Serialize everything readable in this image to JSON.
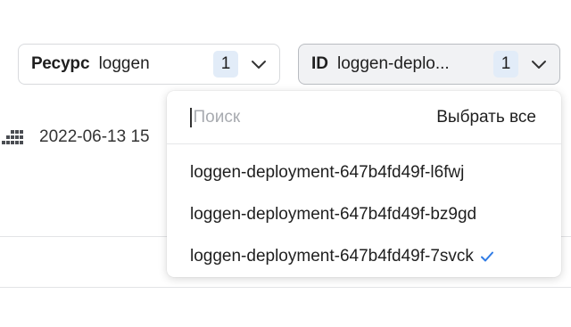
{
  "filters": {
    "resource": {
      "name": "Ресурс",
      "value": "loggen",
      "count": "1"
    },
    "id": {
      "name": "ID",
      "value": "loggen-deplo...",
      "count": "1"
    }
  },
  "row": {
    "date": "2022-06-13 15"
  },
  "dropdown": {
    "search_placeholder": "Поиск",
    "select_all": "Выбрать все",
    "items": [
      {
        "label": "loggen-deployment-647b4fd49f-l6fwj",
        "selected": false
      },
      {
        "label": "loggen-deployment-647b4fd49f-bz9gd",
        "selected": false
      },
      {
        "label": "loggen-deployment-647b4fd49f-7svck",
        "selected": true
      }
    ]
  },
  "colors": {
    "accent": "#2f7be5",
    "count_badge": "#e2ecf8"
  }
}
